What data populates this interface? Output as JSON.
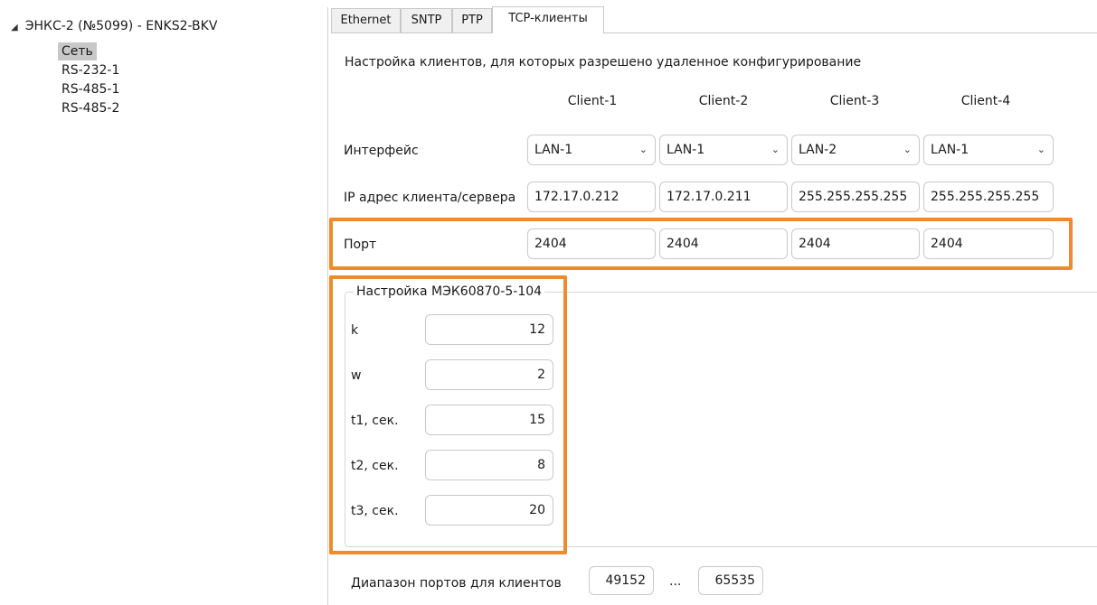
{
  "tree": {
    "root": "ЭНКС-2 (№5099) - ENKS2-BKV",
    "items": [
      "Сеть",
      "RS-232-1",
      "RS-485-1",
      "RS-485-2"
    ]
  },
  "tabs": [
    "Ethernet",
    "SNTP",
    "PTP",
    "TCP-клиенты"
  ],
  "active_tab": "TCP-клиенты",
  "clients": {
    "description": "Настройка клиентов, для которых разрешено удаленное конфигурирование",
    "headers": [
      "Client-1",
      "Client-2",
      "Client-3",
      "Client-4"
    ],
    "interface_label": "Интерфейс",
    "interfaces": [
      "LAN-1",
      "LAN-1",
      "LAN-2",
      "LAN-1"
    ],
    "ip_label": "IP адрес клиента/сервера",
    "ips": [
      "172.17.0.212",
      "172.17.0.211",
      "255.255.255.255",
      "255.255.255.255"
    ],
    "port_label": "Порт",
    "ports": [
      "2404",
      "2404",
      "2404",
      "2404"
    ]
  },
  "iec": {
    "title": "Настройка МЭК60870-5-104",
    "params": [
      {
        "label": "k",
        "value": "12"
      },
      {
        "label": "w",
        "value": "2"
      },
      {
        "label": "t1, сек.",
        "value": "15"
      },
      {
        "label": "t2, сек.",
        "value": "8"
      },
      {
        "label": "t3, сек.",
        "value": "20"
      }
    ]
  },
  "port_range": {
    "label": "Диапазон портов для клиентов",
    "from": "49152",
    "separator": "...",
    "to": "65535"
  },
  "colors": {
    "highlight": "#f08a2b",
    "selected_bg": "#c8c8c8"
  }
}
